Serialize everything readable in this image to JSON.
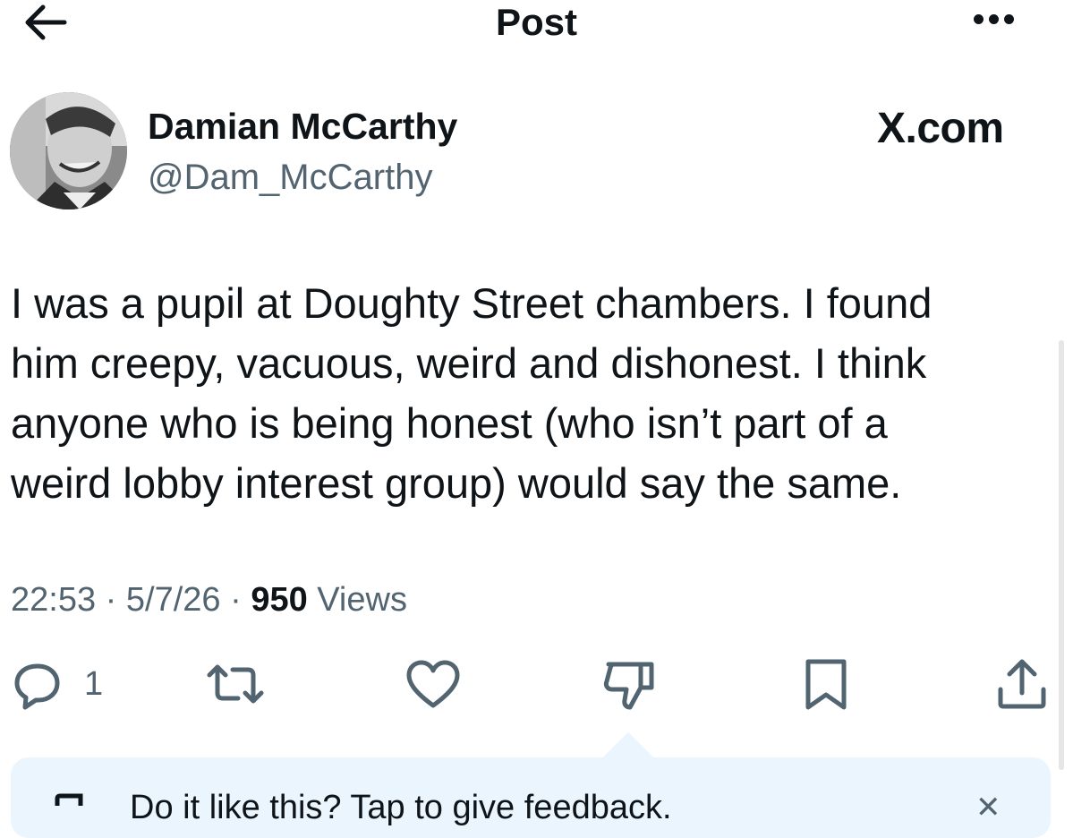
{
  "header": {
    "title": "Post"
  },
  "author": {
    "name": "Damian McCarthy",
    "handle": "@Dam_McCarthy",
    "brand": "X.com"
  },
  "tweet": {
    "text": "I was a pupil at Doughty Street chambers. I found\nhim creepy, vacuous, weird and dishonest. I think\nanyone who is being honest (who isn’t part of a\nweird lobby interest group) would say the same."
  },
  "meta": {
    "time": "22:53",
    "sep1": " · ",
    "date": "5/7/26",
    "sep2": " · ",
    "views_count": "950",
    "views_label": " Views"
  },
  "actions": {
    "reply_count": "1"
  },
  "feedback": {
    "text": "Do it like this? Tap to give feedback."
  },
  "colors": {
    "text": "#0f1419",
    "muted": "#536471",
    "feedback_bg": "#eaf5fd"
  }
}
